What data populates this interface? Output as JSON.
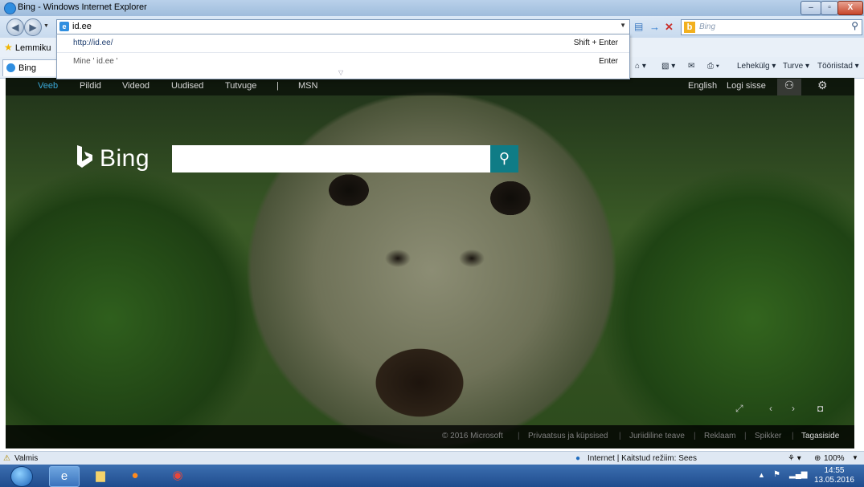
{
  "window": {
    "title": "Bing - Windows Internet Explorer",
    "minimize": "–",
    "restore": "▫",
    "close": "X"
  },
  "address_bar": {
    "value": "id.ee",
    "go_icon": "→",
    "stop_icon": "✕"
  },
  "search_box": {
    "placeholder": "Bing"
  },
  "autocomplete": {
    "items": [
      {
        "left": "http://id.ee/",
        "right": "Shift + Enter"
      },
      {
        "left": "Mine ' id.ee '",
        "right": "Enter"
      }
    ]
  },
  "favorites_bar": {
    "label": "Lemmiku"
  },
  "tabs": [
    {
      "label": "Bing"
    }
  ],
  "command_bar": {
    "page": "Lehekülg",
    "safety": "Turve",
    "tools": "Tööriistad"
  },
  "bing": {
    "nav": [
      "Veeb",
      "Pildid",
      "Videod",
      "Uudised",
      "Tutvuge",
      "|",
      "MSN"
    ],
    "nav_right": [
      "English",
      "Logi sisse"
    ],
    "logo_text": "Bing",
    "footer": [
      "© 2016 Microsoft",
      "Privaatsus ja küpsised",
      "Juriidiline teave",
      "Reklaam",
      "Spikker",
      "Tagasiside"
    ]
  },
  "status_bar": {
    "left": "Valmis",
    "zone": "Internet | Kaitstud režiim: Sees",
    "zoom": "100%"
  },
  "taskbar": {
    "time": "14:55",
    "date": "13.05.2016"
  },
  "colors": {
    "bing_search_button": "#0f7c86",
    "nav_active": "#3aa9d8",
    "titlebar": "#b9d1ea"
  }
}
